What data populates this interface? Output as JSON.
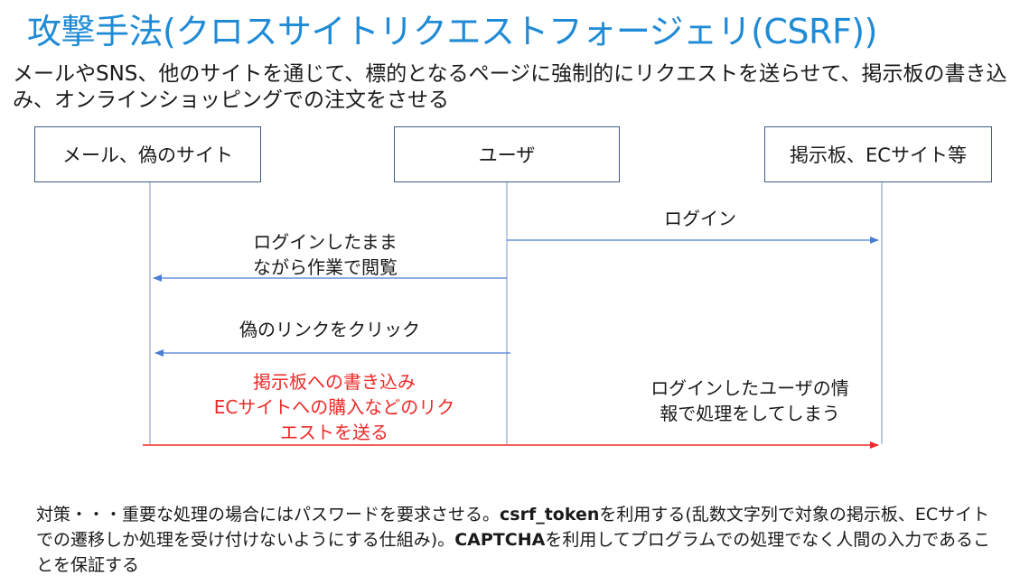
{
  "title": "攻撃手法(クロスサイトリクエストフォージェリ(CSRF))",
  "intro": "メールやSNS、他のサイトを通じて、標的となるページに強制的にリクエストを送らせて、掲示板の書き込み、オンラインショッピングでの注文をさせる",
  "actors": {
    "fake_site": "メール、偽のサイト",
    "user": "ユーザ",
    "target_site": "掲示板、ECサイト等"
  },
  "messages": {
    "login": "ログイン",
    "browse_line1": "ログインしたまま",
    "browse_line2": "ながら作業で閲覧",
    "click_fake_link": "偽のリンクをクリック",
    "forced_line1": "掲示板への書き込み",
    "forced_line2": "ECサイトへの購入などのリク",
    "forced_line3": "エストを送る",
    "processed_line1": "ログインしたユーザの情",
    "processed_line2": "報で処理をしてしまう"
  },
  "countermeasure": {
    "part1": "対策・・・重要な処理の場合にはパスワードを要求させる。",
    "token": "csrf_token",
    "part2": "を利用する(乱数文字列で対象の掲示板、ECサイトでの遷移しか処理を受け付けないようにする仕組み)。",
    "captcha": "CAPTCHA",
    "part3": "を利用してプログラムでの処理でなく人間の入力であることを保証する"
  },
  "colors": {
    "title": "#1f8bd6",
    "arrow": "#4a7fd4",
    "attack": "#ee2a2a",
    "lifeline": "#8ea6cf"
  }
}
